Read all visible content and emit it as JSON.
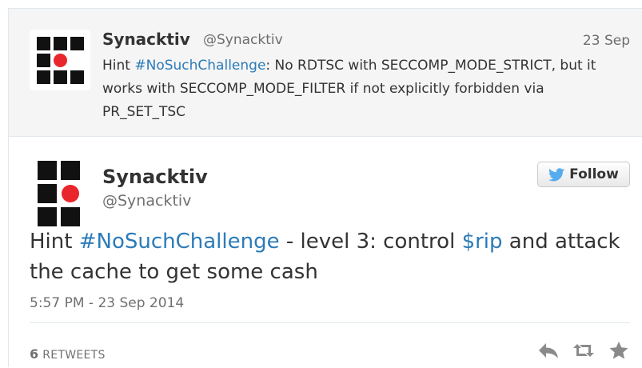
{
  "parent_tweet": {
    "author_name": "Synacktiv",
    "author_handle": "@Synacktiv",
    "date": "23 Sep",
    "text_prefix": "Hint ",
    "hashtag": "#NoSuchChallenge",
    "text_suffix": ": No RDTSC with SECCOMP_MODE_STRICT, but it works with SECCOMP_MODE_FILTER if not explicitly forbidden via PR_SET_TSC"
  },
  "tweet": {
    "author_name": "Synacktiv",
    "author_handle": "@Synacktiv",
    "follow_label": "Follow",
    "text_prefix": "Hint ",
    "hashtag": "#NoSuchChallenge",
    "text_middle": " - level 3: control ",
    "cashtag": "$rip",
    "text_suffix": " and attack the cache to get some cash",
    "timestamp": "5:57 PM - 23 Sep 2014",
    "retweet_count": "6",
    "retweet_label": "RETWEETS"
  },
  "colors": {
    "link": "#2b7bb9",
    "logo_dark": "#111111",
    "logo_red": "#e8262b",
    "twitter_bird": "#55acee",
    "action_icons": "#8a8a8a"
  },
  "icons": {
    "follow": "twitter-bird-icon",
    "reply": "reply-icon",
    "retweet": "retweet-icon",
    "favorite": "star-icon"
  }
}
